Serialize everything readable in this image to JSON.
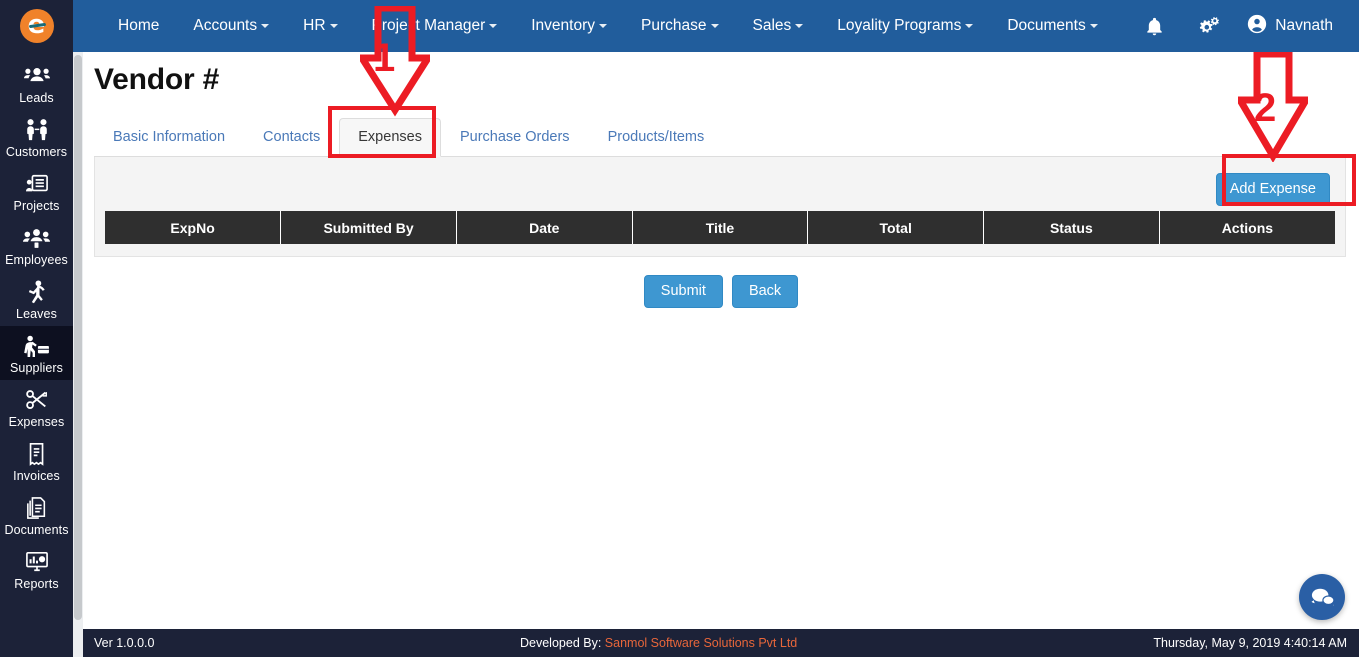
{
  "branding": {
    "logo_alt": "b-logo"
  },
  "topnav": {
    "items": [
      {
        "label": "Home",
        "caret": false
      },
      {
        "label": "Accounts",
        "caret": true
      },
      {
        "label": "HR",
        "caret": true
      },
      {
        "label": "Project Manager",
        "caret": true
      },
      {
        "label": "Inventory",
        "caret": true
      },
      {
        "label": "Purchase",
        "caret": true
      },
      {
        "label": "Sales",
        "caret": true
      },
      {
        "label": "Loyality Programs",
        "caret": true
      },
      {
        "label": "Documents",
        "caret": true
      }
    ],
    "notification_icon": "bell-icon",
    "settings_icon": "gears-icon",
    "user_icon": "user-circle-icon",
    "user_name": "Navnath",
    "background_color": "#215d9c"
  },
  "sidebar": {
    "background_color": "#1c2238",
    "active_background_color": "#0d1020",
    "items": [
      {
        "label": "Leads",
        "icon": "leads-icon",
        "active": false
      },
      {
        "label": "Customers",
        "icon": "customers-icon",
        "active": false
      },
      {
        "label": "Projects",
        "icon": "projects-icon",
        "active": false
      },
      {
        "label": "Employees",
        "icon": "employees-icon",
        "active": false
      },
      {
        "label": "Leaves",
        "icon": "leaves-icon",
        "active": false
      },
      {
        "label": "Suppliers",
        "icon": "suppliers-icon",
        "active": true
      },
      {
        "label": "Expenses",
        "icon": "expenses-icon",
        "active": false
      },
      {
        "label": "Invoices",
        "icon": "invoices-icon",
        "active": false
      },
      {
        "label": "Documents",
        "icon": "documents-icon",
        "active": false
      },
      {
        "label": "Reports",
        "icon": "reports-icon",
        "active": false
      }
    ]
  },
  "page": {
    "title": "Vendor #",
    "tabs": [
      {
        "label": "Basic Information",
        "active": false
      },
      {
        "label": "Contacts",
        "active": false
      },
      {
        "label": "Expenses",
        "active": true
      },
      {
        "label": "Purchase Orders",
        "active": false
      },
      {
        "label": "Products/Items",
        "active": false
      }
    ],
    "toolbar": {
      "add_expense_label": "Add Expense"
    },
    "table": {
      "columns": [
        "ExpNo",
        "Submitted By",
        "Date",
        "Title",
        "Total",
        "Status",
        "Actions"
      ],
      "rows": [],
      "header_background": "#2f2f2f"
    },
    "form_buttons": {
      "submit_label": "Submit",
      "back_label": "Back"
    }
  },
  "chat": {
    "icon": "chat-bubbles-icon"
  },
  "footer": {
    "version": "Ver 1.0.0.0",
    "developed_by_label": "Developed By:",
    "developer_name": "Sanmol Software Solutions Pvt Ltd",
    "datetime": "Thursday, May 9, 2019 4:40:14 AM",
    "developer_link_color": "#e8663a"
  },
  "annotations": {
    "color": "#ec1c24",
    "markers": [
      {
        "number": "1",
        "target": "expenses-tab"
      },
      {
        "number": "2",
        "target": "add-expense-button"
      }
    ]
  }
}
